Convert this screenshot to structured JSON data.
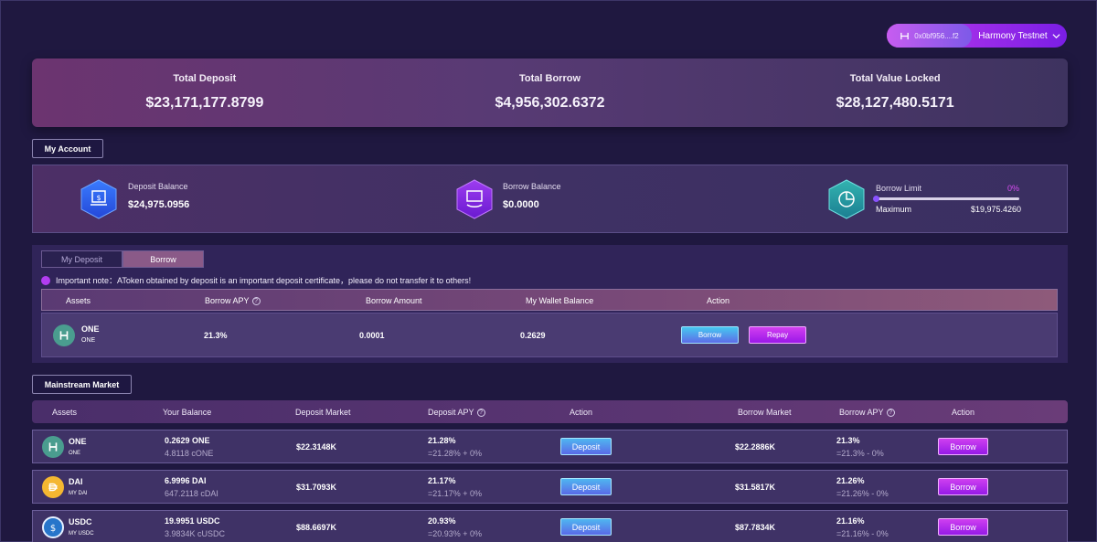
{
  "header": {
    "wallet_address": "0x0bf956....f2",
    "network": "Harmony Testnet"
  },
  "stats": {
    "total_deposit_label": "Total Deposit",
    "total_deposit_value": "$23,171,177.8799",
    "total_borrow_label": "Total Borrow",
    "total_borrow_value": "$4,956,302.6372",
    "tvl_label": "Total Value Locked",
    "tvl_value": "$28,127,480.5171"
  },
  "my_account": {
    "title": "My Account",
    "deposit_balance_label": "Deposit Balance",
    "deposit_balance_value": "$24,975.0956",
    "borrow_balance_label": "Borrow Balance",
    "borrow_balance_value": "$0.0000",
    "borrow_limit_label": "Borrow Limit",
    "borrow_limit_percent": "0%",
    "borrow_limit_fraction": 0,
    "maximum_label": "Maximum",
    "maximum_value": "$19,975.4260"
  },
  "borrow_panel": {
    "tabs": [
      "My Deposit",
      "Borrow"
    ],
    "active_tab": "Borrow",
    "note": "Important note：AToken obtained by deposit is an important deposit certificate，please do not transfer it to others!",
    "columns": [
      "Assets",
      "Borrow APY",
      "Borrow Amount",
      "My Wallet Balance",
      "Action"
    ],
    "row": {
      "asset": "ONE",
      "asset_sub": "ONE",
      "apy": "21.3%",
      "amount": "0.0001",
      "wallet_balance": "0.2629",
      "borrow_label": "Borrow",
      "repay_label": "Repay"
    }
  },
  "market": {
    "title": "Mainstream Market",
    "columns": [
      "Assets",
      "Your Balance",
      "Deposit Market",
      "Deposit APY",
      "Action",
      "Borrow Market",
      "Borrow APY",
      "Action"
    ],
    "rows": [
      {
        "asset": "ONE",
        "asset_sub": "ONE",
        "balance": "0.2629 ONE",
        "balance_sub": "4.8118 cONE",
        "deposit_market": "$22.3148K",
        "deposit_apy": "21.28%",
        "deposit_apy_sub": "=21.28% + 0%",
        "deposit_label": "Deposit",
        "borrow_market": "$22.2886K",
        "borrow_apy": "21.3%",
        "borrow_apy_sub": "=21.3% - 0%",
        "borrow_label": "Borrow",
        "coin_color": "#4a9d8f"
      },
      {
        "asset": "DAI",
        "asset_sub": "MY DAI",
        "balance": "6.9996 DAI",
        "balance_sub": "647.2118 cDAI",
        "deposit_market": "$31.7093K",
        "deposit_apy": "21.17%",
        "deposit_apy_sub": "=21.17% + 0%",
        "deposit_label": "Deposit",
        "borrow_market": "$31.5817K",
        "borrow_apy": "21.26%",
        "borrow_apy_sub": "=21.26% - 0%",
        "borrow_label": "Borrow",
        "coin_color": "#f4b731"
      },
      {
        "asset": "USDC",
        "asset_sub": "MY USDC",
        "balance": "19.9951 USDC",
        "balance_sub": "3.9834K cUSDC",
        "deposit_market": "$88.6697K",
        "deposit_apy": "20.93%",
        "deposit_apy_sub": "=20.93% + 0%",
        "deposit_label": "Deposit",
        "borrow_market": "$87.7834K",
        "borrow_apy": "21.16%",
        "borrow_apy_sub": "=21.16% - 0%",
        "borrow_label": "Borrow",
        "coin_color": "#2775ca"
      }
    ]
  }
}
